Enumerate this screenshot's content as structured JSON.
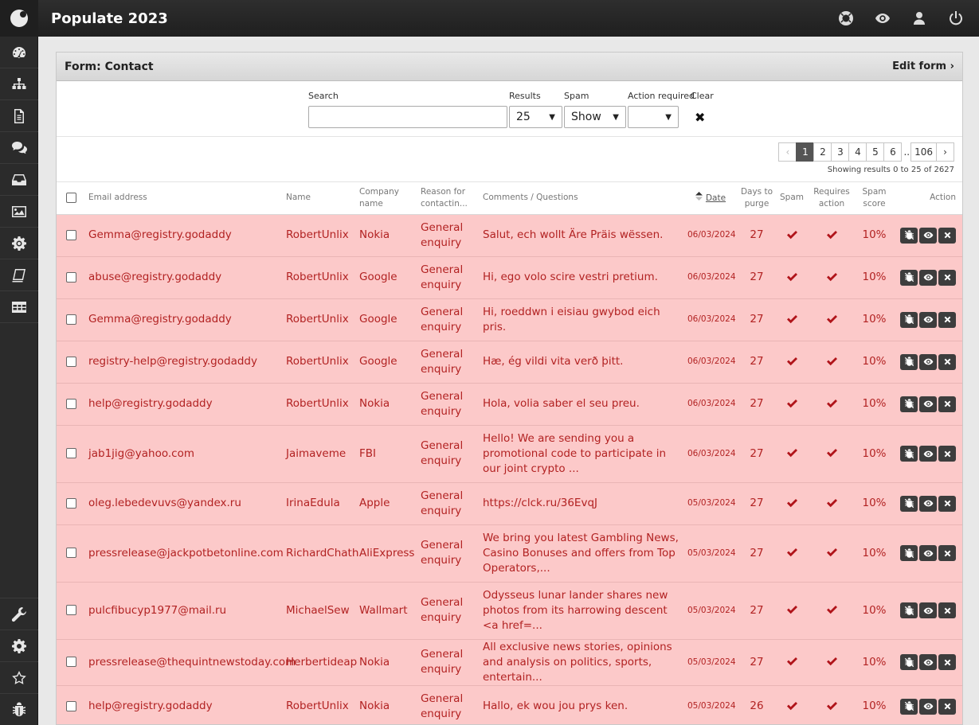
{
  "app": {
    "title": "Populate 2023"
  },
  "sidebar": {
    "items": [
      {
        "name": "dashboard",
        "icon": "dashboard-icon"
      },
      {
        "name": "sitemap",
        "icon": "sitemap-icon"
      },
      {
        "name": "pages",
        "icon": "document-icon"
      },
      {
        "name": "forms",
        "icon": "chat-icon"
      },
      {
        "name": "inbox",
        "icon": "inbox-icon"
      },
      {
        "name": "media",
        "icon": "image-icon"
      },
      {
        "name": "settings",
        "icon": "gear-icon"
      },
      {
        "name": "books",
        "icon": "book-icon"
      },
      {
        "name": "tables",
        "icon": "table-icon"
      }
    ],
    "bottom_items": [
      {
        "name": "tools",
        "icon": "wrench-icon"
      },
      {
        "name": "config",
        "icon": "cog-icon"
      },
      {
        "name": "favourites",
        "icon": "star-icon"
      },
      {
        "name": "debug",
        "icon": "bug-icon"
      }
    ]
  },
  "topbar": {
    "icons": [
      "help-icon",
      "preview-icon",
      "user-icon",
      "power-icon"
    ]
  },
  "panel": {
    "title": "Form: Contact",
    "edit_label": "Edit form"
  },
  "filters": {
    "search_label": "Search",
    "search_value": "",
    "results_label": "Results",
    "results_value": "25",
    "spam_label": "Spam",
    "spam_value": "Show",
    "action_label": "Action required",
    "action_value": "",
    "clear_label": "Clear"
  },
  "pagination": {
    "pages": [
      "1",
      "2",
      "3",
      "4",
      "5",
      "6"
    ],
    "dots": "..",
    "last": "106",
    "current": "1",
    "showing": "Showing results 0 to 25 of 2627"
  },
  "table": {
    "headers": {
      "email": "Email address",
      "name": "Name",
      "company": "Company name",
      "reason": "Reason for contactin...",
      "comments": "Comments / Questions",
      "date": "Date",
      "days": "Days to purge",
      "spam": "Spam",
      "requires": "Requires action",
      "score": "Spam score",
      "action": "Action"
    },
    "rows": [
      {
        "email": "Gemma@registry.godaddy",
        "name": "RobertUnlix",
        "company": "Nokia",
        "reason": "General enquiry",
        "comment": "Salut, ech wollt Äre Präis wëssen.",
        "date": "06/03/2024",
        "days": "27",
        "score": "10%"
      },
      {
        "email": "abuse@registry.godaddy",
        "name": "RobertUnlix",
        "company": "Google",
        "reason": "General enquiry",
        "comment": "Hi, ego volo scire vestri pretium.",
        "date": "06/03/2024",
        "days": "27",
        "score": "10%"
      },
      {
        "email": "Gemma@registry.godaddy",
        "name": "RobertUnlix",
        "company": "Google",
        "reason": "General enquiry",
        "comment": "Hi, roeddwn i eisiau gwybod eich pris.",
        "date": "06/03/2024",
        "days": "27",
        "score": "10%"
      },
      {
        "email": "registry-help@registry.godaddy",
        "name": "RobertUnlix",
        "company": "Google",
        "reason": "General enquiry",
        "comment": "Hæ, ég vildi vita verð þitt.",
        "date": "06/03/2024",
        "days": "27",
        "score": "10%"
      },
      {
        "email": "help@registry.godaddy",
        "name": "RobertUnlix",
        "company": "Nokia",
        "reason": "General enquiry",
        "comment": "Hola, volia saber el seu preu.",
        "date": "06/03/2024",
        "days": "27",
        "score": "10%"
      },
      {
        "email": "jab1jig@yahoo.com",
        "name": "Jaimaveme",
        "company": "FBI",
        "reason": "General enquiry",
        "comment": "Hello! We are sending you a promotional code to participate in our joint crypto ...",
        "date": "06/03/2024",
        "days": "27",
        "score": "10%"
      },
      {
        "email": "oleg.lebedevuvs@yandex.ru",
        "name": "IrinaEdula",
        "company": "Apple",
        "reason": "General enquiry",
        "comment": "https://clck.ru/36EvqJ",
        "date": "05/03/2024",
        "days": "27",
        "score": "10%"
      },
      {
        "email": "pressrelease@jackpotbetonline.com",
        "name": "RichardChath",
        "company": "AliExpress",
        "reason": "General enquiry",
        "comment": "We bring you latest Gambling News, Casino Bonuses and offers from Top Operators,...",
        "date": "05/03/2024",
        "days": "27",
        "score": "10%"
      },
      {
        "email": "pulcfibucyp1977@mail.ru",
        "name": "MichaelSew",
        "company": "Wallmart",
        "reason": "General enquiry",
        "comment": "Odysseus lunar lander shares new photos from its harrowing descent <a href=...",
        "date": "05/03/2024",
        "days": "27",
        "score": "10%"
      },
      {
        "email": "pressrelease@thequintnewstoday.com",
        "name": "Herbertideap",
        "company": "Nokia",
        "reason": "General enquiry",
        "comment": "All exclusive news stories, opinions and analysis on politics, sports, entertain...",
        "date": "05/03/2024",
        "days": "27",
        "score": "10%"
      },
      {
        "email": "help@registry.godaddy",
        "name": "RobertUnlix",
        "company": "Nokia",
        "reason": "General enquiry",
        "comment": "Hallo, ek wou jou prys ken.",
        "date": "05/03/2024",
        "days": "26",
        "score": "10%"
      }
    ]
  },
  "colors": {
    "row_bg": "#fcc9c9",
    "row_text": "#b22222",
    "tick": "#b0141a"
  }
}
